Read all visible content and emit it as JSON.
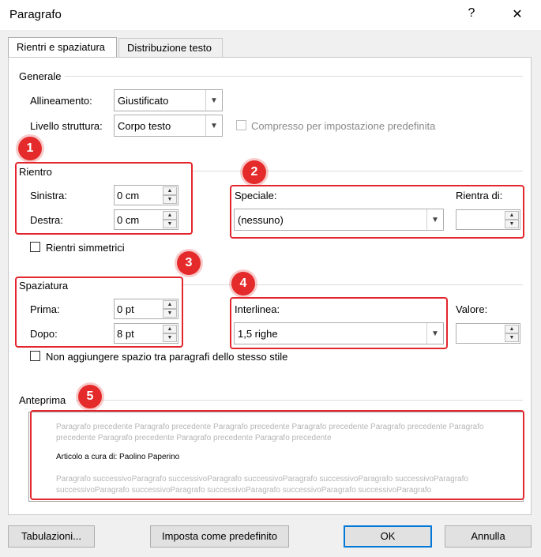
{
  "window": {
    "title": "Paragrafo",
    "help": "?",
    "close": "✕"
  },
  "tabs": [
    {
      "label": "Rientri e spaziatura",
      "active": true
    },
    {
      "label": "Distribuzione testo",
      "active": false
    }
  ],
  "general": {
    "title": "Generale",
    "alignment_label": "Allineamento:",
    "alignment_value": "Giustificato",
    "outline_label": "Livello struttura:",
    "outline_value": "Corpo testo",
    "collapsed_label": "Compresso per impostazione predefinita",
    "collapsed_checked": false
  },
  "indent": {
    "title": "Rientro",
    "left_label": "Sinistra:",
    "left_value": "0 cm",
    "right_label": "Destra:",
    "right_value": "0 cm",
    "special_label": "Speciale:",
    "special_value": "(nessuno)",
    "by_label": "Rientra di:",
    "by_value": "",
    "mirror_label": "Rientri simmetrici",
    "mirror_checked": false
  },
  "spacing": {
    "title": "Spaziatura",
    "before_label": "Prima:",
    "before_value": "0 pt",
    "after_label": "Dopo:",
    "after_value": "8 pt",
    "line_label": "Interlinea:",
    "line_value": "1,5 righe",
    "at_label": "Valore:",
    "at_value": "",
    "no_space_label": "Non aggiungere spazio tra paragrafi dello stesso stile",
    "no_space_checked": false
  },
  "preview": {
    "title": "Anteprima",
    "prev_line1": "Paragrafo precedente Paragrafo precedente Paragrafo precedente Paragrafo precedente Paragrafo precedente Paragrafo",
    "prev_line2": "precedente Paragrafo precedente Paragrafo precedente Paragrafo precedente",
    "sample": "Articolo a cura di: Paolino Paperino",
    "next_line1": "Paragrafo successivoParagrafo successivoParagrafo successivoParagrafo successivoParagrafo successivoParagrafo",
    "next_line2": "successivoParagrafo successivoParagrafo successivoParagrafo successivoParagrafo successivoParagrafo"
  },
  "badges": [
    "1",
    "2",
    "3",
    "4",
    "5"
  ],
  "buttons": {
    "tabs": "Tabulazioni...",
    "default": "Imposta come predefinito",
    "ok": "OK",
    "cancel": "Annulla"
  },
  "colors": {
    "highlight": "#e3262d",
    "default_button_border": "#0078d7"
  }
}
